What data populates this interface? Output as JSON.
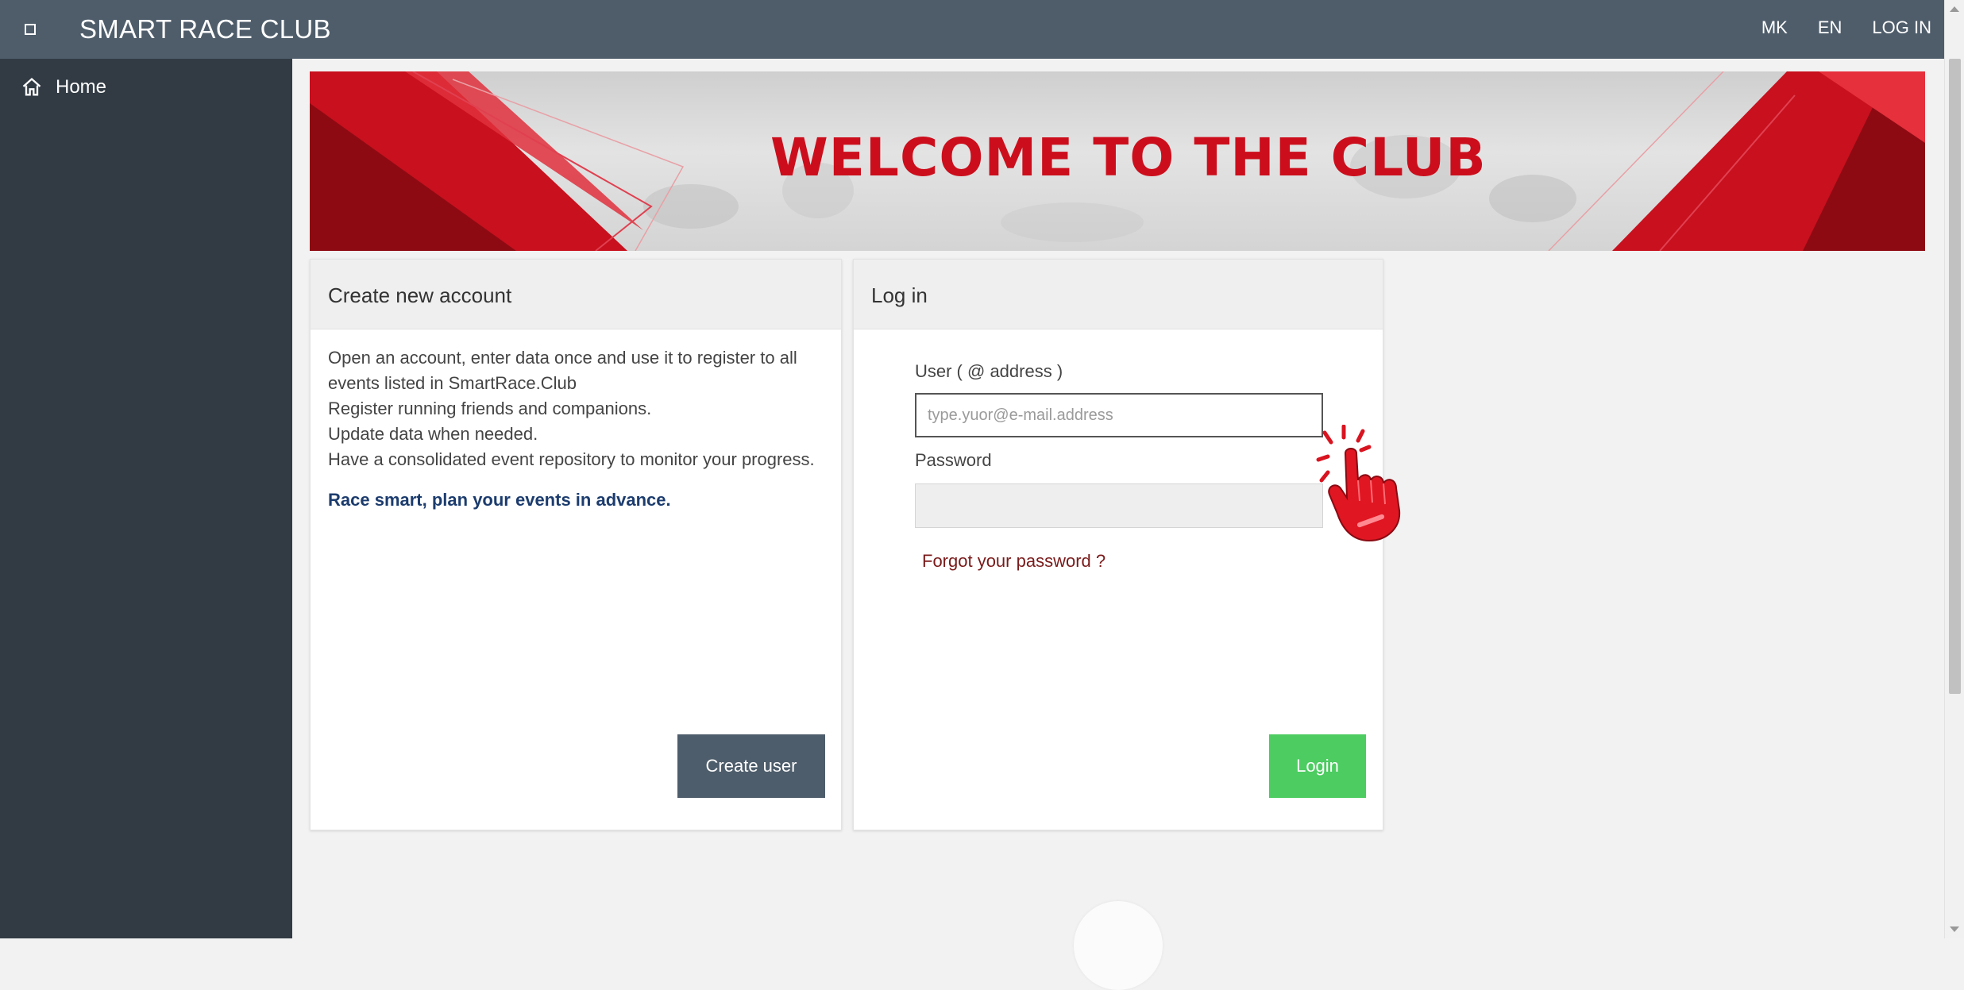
{
  "app": {
    "brand": "SMART RACE CLUB"
  },
  "topnav": {
    "items": [
      "MK",
      "EN",
      "LOG IN"
    ]
  },
  "sidebar": {
    "items": [
      {
        "label": "Home",
        "icon": "home-icon"
      }
    ]
  },
  "banner": {
    "title": "WELCOME TO THE CLUB"
  },
  "create_account": {
    "heading": "Create new account",
    "lines": [
      "Open an account, enter data once and use it to register to all events listed in SmartRace.Club",
      "Register running friends and companions.",
      "Update data when needed.",
      "Have a consolidated event repository to monitor your progress."
    ],
    "slogan": "Race smart, plan your events in advance.",
    "button_label": "Create user"
  },
  "login": {
    "heading": "Log in",
    "user_label": "User ( @ address )",
    "user_placeholder": "type.yuor@e-mail.address",
    "user_value": "",
    "password_label": "Password",
    "password_value": "",
    "forgot_label": "Forgot your password ?",
    "button_label": "Login"
  },
  "colors": {
    "topbar": "#4f5d6b",
    "sidebar": "#323b44",
    "accent_red": "#cc0e1c",
    "login_button": "#4ccc61",
    "create_button": "#4e5d6b",
    "slogan": "#1c3c6e",
    "forgot_link": "#7a1a1a"
  },
  "icons": {
    "menu": "menu-toggle-icon",
    "home": "home-icon",
    "pointer": "tap-hand-icon"
  }
}
